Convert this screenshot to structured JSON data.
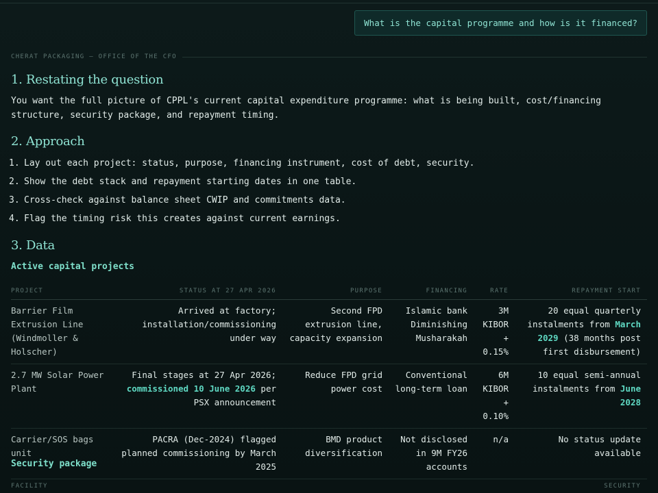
{
  "query": "What is the capital programme and how is it financed?",
  "header_label": "CHERAT PACKAGING — OFFICE OF THE CFO",
  "sections": {
    "s1": {
      "heading": "1. Restating the question",
      "text": "You want the full picture of CPPL's current capital expenditure programme: what is being built, cost/financing structure, security package, and repayment timing."
    },
    "s2": {
      "heading": "2. Approach",
      "steps": [
        {
          "num": "1.",
          "text": "Lay out each project: status, purpose, financing instrument, cost of debt, security."
        },
        {
          "num": "2.",
          "text": "Show the debt stack and repayment starting dates in one table."
        },
        {
          "num": "3.",
          "text": "Cross-check against balance sheet CWIP and commitments data."
        },
        {
          "num": "4.",
          "text": "Flag the timing risk this creates against current earnings."
        }
      ]
    },
    "s3": {
      "heading": "3. Data",
      "sub1": "Active capital projects",
      "sub2": "Security package"
    }
  },
  "projects_table": {
    "headers": {
      "project": "PROJECT",
      "status": "STATUS AT 27 APR 2026",
      "purpose": "PURPOSE",
      "financing": "FINANCING",
      "rate": "RATE",
      "repayment": "REPAYMENT START"
    },
    "rows": [
      {
        "project": "Barrier Film Extrusion Line (Windmoller & Holscher)",
        "status_pre": "Arrived at factory; installation/commissioning under way",
        "status_hl": "",
        "status_post": "",
        "purpose": "Second FPD extrusion line, capacity expansion",
        "financing": "Islamic bank Diminishing Musharakah",
        "rate": "3M KIBOR + 0.15%",
        "repay_pre": "20 equal quarterly instalments from ",
        "repay_hl": "March 2029",
        "repay_post": " (38 months post first disbursement)"
      },
      {
        "project": "2.7 MW Solar Power Plant",
        "status_pre": "Final stages at 27 Apr 2026; ",
        "status_hl": "commissioned 10 June 2026",
        "status_post": " per PSX announcement",
        "purpose": "Reduce FPD grid power cost",
        "financing": "Conventional long-term loan",
        "rate": "6M KIBOR + 0.10%",
        "repay_pre": "10 equal semi-annual instalments from ",
        "repay_hl": "June 2028",
        "repay_post": ""
      },
      {
        "project": "Carrier/SOS bags unit",
        "status_pre": "PACRA (Dec-2024) flagged planned commissioning by March 2025",
        "status_hl": "",
        "status_post": "",
        "purpose": "BMD product diversification",
        "financing": "Not disclosed in 9M FY26 accounts",
        "rate": "n/a",
        "repay_pre": "No status update available",
        "repay_hl": "",
        "repay_post": ""
      }
    ]
  },
  "security_table": {
    "headers": {
      "facility": "FACILITY",
      "security": "SECURITY"
    }
  },
  "colors": {
    "background": "#0b1717",
    "accent": "#8fe3d3",
    "highlight": "#5fd8c2",
    "muted": "#5c7470"
  }
}
